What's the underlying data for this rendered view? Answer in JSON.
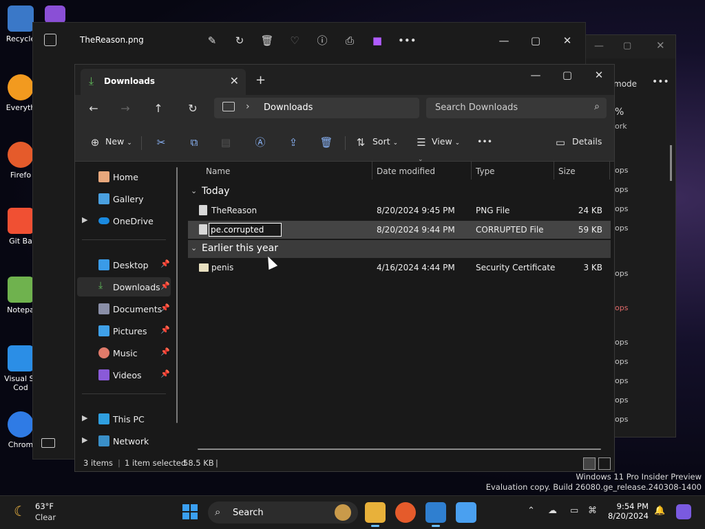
{
  "desktop": {
    "icons": [
      {
        "label": "Recycle",
        "color": "#3a78c8"
      },
      {
        "label": "Everyth",
        "color": "#f29a1f"
      },
      {
        "label": "Firefo",
        "color": "#e55b2b"
      },
      {
        "label": "Git Ba",
        "color": "#f05033"
      },
      {
        "label": "Notepa",
        "color": "#6fb24e"
      },
      {
        "label": "Visual St Cod",
        "color": "#2b8ee6"
      },
      {
        "label": "Chrom",
        "color": "#2f7be5"
      }
    ]
  },
  "bg_window": {
    "mode_label": "mode",
    "pct": "%",
    "ork": "ork",
    "rows": [
      "ops",
      "ops",
      "ops",
      "ops",
      "ops",
      "ops",
      "ops",
      "ops",
      "ops",
      "ops",
      "ops",
      "ops",
      "ops"
    ]
  },
  "photos": {
    "title": "TheReason.png",
    "icons": [
      "edit-icon",
      "rotate-icon",
      "delete-icon",
      "favorite-icon",
      "info-icon",
      "print-icon",
      "clipchamp-icon",
      "more-icon"
    ]
  },
  "explorer": {
    "tab_title": "Downloads",
    "breadcrumb": "Downloads",
    "search_placeholder": "Search Downloads",
    "toolbar": {
      "new_label": "New",
      "sort_label": "Sort",
      "view_label": "View",
      "more_label": "•••",
      "details_label": "Details"
    },
    "sidebar": {
      "home": "Home",
      "gallery": "Gallery",
      "onedrive": "OneDrive",
      "desktop": "Desktop",
      "downloads": "Downloads",
      "documents": "Documents",
      "pictures": "Pictures",
      "music": "Music",
      "videos": "Videos",
      "thispc": "This PC",
      "network": "Network"
    },
    "columns": {
      "name": "Name",
      "date": "Date modified",
      "type": "Type",
      "size": "Size"
    },
    "groups": {
      "today": "Today",
      "earlier": "Earlier this year"
    },
    "files": [
      {
        "name": "TheReason",
        "date": "8/20/2024 9:45 PM",
        "type": "PNG File",
        "size": "24 KB"
      },
      {
        "name": "pe.corrupted",
        "date": "8/20/2024 9:44 PM",
        "type": "CORRUPTED File",
        "size": "59 KB"
      },
      {
        "name": "penis",
        "date": "4/16/2024 4:44 PM",
        "type": "Security Certificate",
        "size": "3 KB"
      }
    ],
    "status": {
      "items": "3 items",
      "selected": "1 item selected",
      "size": "58.5 KB"
    }
  },
  "watermark": {
    "line1": "Windows 11 Pro Insider Preview",
    "line2": "Evaluation copy. Build 26080.ge_release.240308-1400"
  },
  "taskbar": {
    "temp": "63°F",
    "condition": "Clear",
    "search_label": "Search",
    "time": "9:54 PM",
    "date": "8/20/2024"
  },
  "colors": {
    "accent": "#6cc1ff",
    "downloads_green": "#5fb95a",
    "folder_blue": "#3aa0f3"
  }
}
